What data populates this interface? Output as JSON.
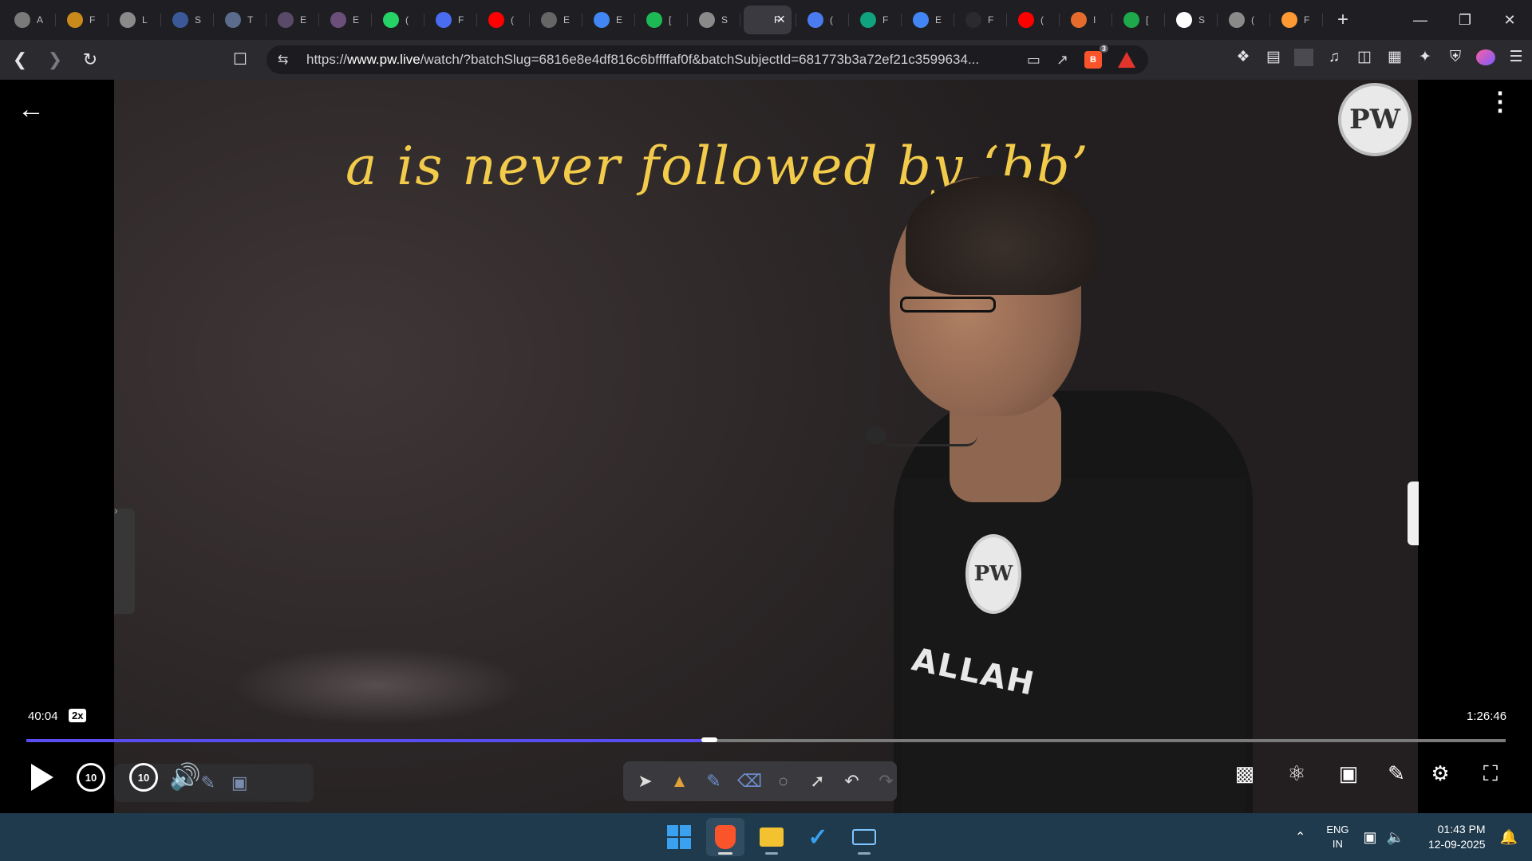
{
  "browser": {
    "tabs": [
      {
        "icon": "chatgpt-icon",
        "label": "A",
        "color": "#7a7a7a"
      },
      {
        "icon": "bitcoin-icon",
        "label": "F",
        "color": "#c9891b"
      },
      {
        "icon": "globe-icon",
        "label": "L",
        "color": "#8a8a8a"
      },
      {
        "icon": "sql-icon",
        "label": "S",
        "color": "#3b5998"
      },
      {
        "icon": "w3schools-icon",
        "label": "T",
        "color": "#5a6b8c"
      },
      {
        "icon": "globe-icon",
        "label": "E",
        "color": "#5a4a6a"
      },
      {
        "icon": "globe-icon",
        "label": "E",
        "color": "#6b4f7a"
      },
      {
        "icon": "whatsapp-icon",
        "label": "(",
        "color": "#25d366"
      },
      {
        "icon": "bookmark-app-icon",
        "label": "F",
        "color": "#4a6cf0"
      },
      {
        "icon": "youtube-icon",
        "label": "(",
        "color": "#ff0000"
      },
      {
        "icon": "orbit-icon",
        "label": "E",
        "color": "#666666"
      },
      {
        "icon": "google-icon",
        "label": "E",
        "color": "#4285f4"
      },
      {
        "icon": "spotify-icon",
        "label": "[",
        "color": "#1db954"
      },
      {
        "icon": "globe-icon",
        "label": "S",
        "color": "#8a8a8a"
      },
      {
        "icon": "pw-icon",
        "label": "F",
        "color": "#3a3a40",
        "active": true
      },
      {
        "icon": "gemini-icon",
        "label": "(",
        "color": "#4a7bf0"
      },
      {
        "icon": "copilot-icon",
        "label": "F",
        "color": "#10a37f"
      },
      {
        "icon": "google-icon",
        "label": "E",
        "color": "#4285f4"
      },
      {
        "icon": "monitor-icon",
        "label": "F",
        "color": "#2a2a2f"
      },
      {
        "icon": "youtube-icon",
        "label": "(",
        "color": "#ff0000"
      },
      {
        "icon": "burger-icon",
        "label": "I",
        "color": "#e46b2b"
      },
      {
        "icon": "handwriting-icon",
        "label": "[",
        "color": "#1ea94a"
      },
      {
        "icon": "wikipedia-icon",
        "label": "S",
        "color": "#ffffff"
      },
      {
        "icon": "globe-icon",
        "label": "(",
        "color": "#8a8a8a"
      },
      {
        "icon": "india-flag-icon",
        "label": "F",
        "color": "#ff9933"
      }
    ],
    "url_scheme": "https://",
    "url_host": "www.pw.live",
    "url_path": "/watch/?batchSlug=6816e8e4df816c6bffffaf0f&batchSubjectId=681773b3a72ef21c3599634...",
    "shield_count": "3"
  },
  "video": {
    "board_text": "a is never followed by ‘bb’",
    "watermark": "PW",
    "shirt_logo": "PW",
    "shirt_text": "ALLAH",
    "current_time": "40:04",
    "speed": "2x",
    "total_time": "1:26:46",
    "progress": 0.4615,
    "skip_back": "10",
    "skip_forward": "10"
  },
  "taskbar": {
    "lang_1": "ENG",
    "lang_2": "IN",
    "time": "01:43 PM",
    "date": "12-09-2025"
  },
  "colors": {
    "accent_progress": "#5a4df0",
    "board_chalk": "#f2cb4a",
    "taskbar": "#1f3a4d"
  }
}
